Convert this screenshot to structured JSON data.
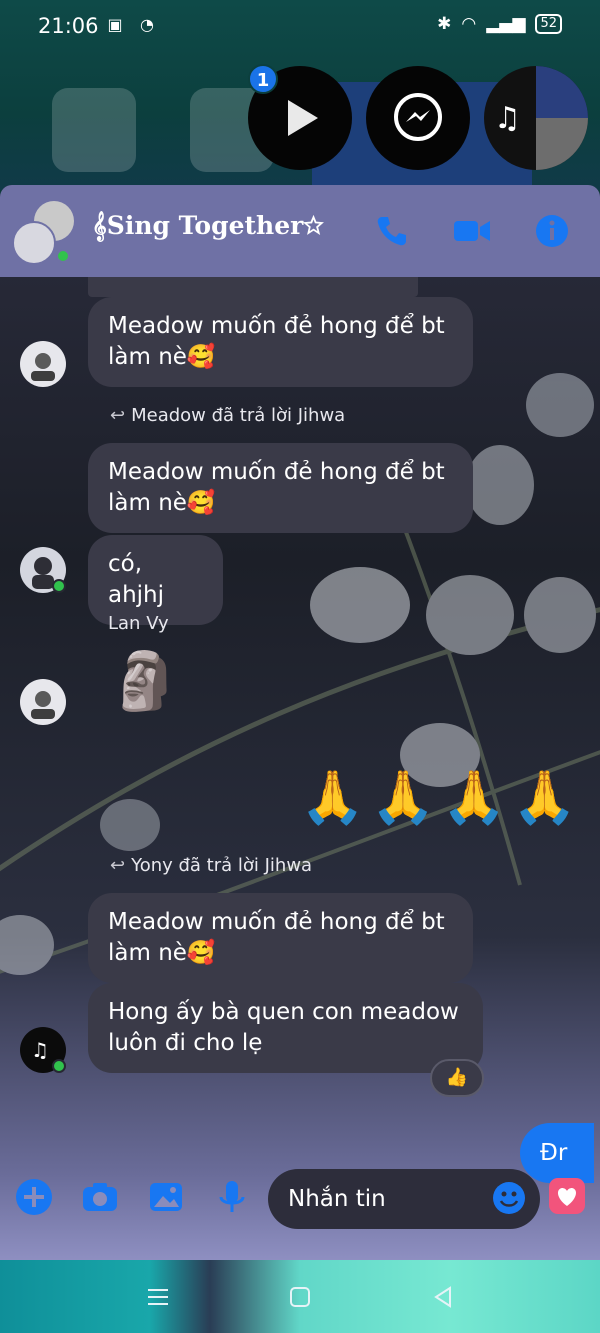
{
  "status_bar": {
    "time": "21:06",
    "battery": "52"
  },
  "home_screen": {
    "bubble_badge": "1"
  },
  "chat": {
    "title": "𝄞Sing Together☆",
    "header_icons": [
      "phone-icon",
      "video-call-icon",
      "info-icon"
    ],
    "messages": [
      {
        "type": "incoming",
        "text": "Meadow muốn đẻ hong để bt làm nè🥰"
      },
      {
        "type": "reply-context",
        "text": "Meadow đã trả lời Jihwa"
      },
      {
        "type": "incoming",
        "text": "Meadow muốn đẻ hong để bt làm nè🥰"
      },
      {
        "type": "incoming",
        "text": "có, ahjhj"
      },
      {
        "type": "sender",
        "text": "Lan Vy"
      },
      {
        "type": "sticker",
        "text": "🗿"
      },
      {
        "type": "outgoing-emoji",
        "text": "🙏🙏🙏🙏"
      },
      {
        "type": "reply-context",
        "text": "Yony đã trả lời Jihwa"
      },
      {
        "type": "incoming",
        "text": "Meadow muốn đẻ hong để bt làm nè🥰"
      },
      {
        "type": "incoming",
        "text": "Hong ấy bà quen con meadow luôn đi cho lẹ"
      },
      {
        "type": "outgoing",
        "text": "Đr"
      }
    ],
    "reaction": "👍"
  },
  "composer": {
    "placeholder": "Nhắn tin"
  },
  "colors": {
    "accent": "#1877f2",
    "header_bg": "#6f71a5",
    "bubble_bg": "#3a3a48",
    "online": "#31c24d"
  }
}
